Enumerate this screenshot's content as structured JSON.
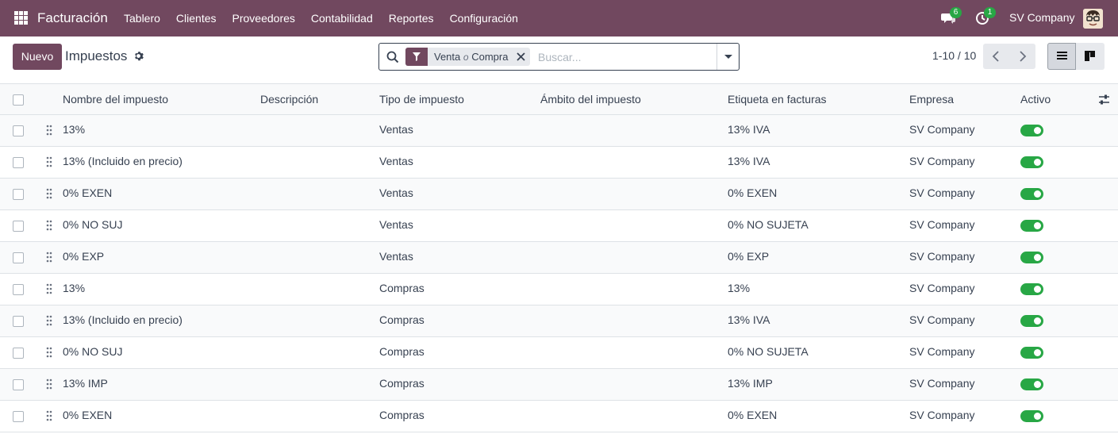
{
  "navbar": {
    "brand": "Facturación",
    "menu": [
      "Tablero",
      "Clientes",
      "Proveedores",
      "Contabilidad",
      "Reportes",
      "Configuración"
    ],
    "messages_badge": "6",
    "activities_badge": "1",
    "company": "SV Company"
  },
  "control_panel": {
    "new_button": "Nuevo",
    "title": "Impuestos",
    "facet": {
      "value1": "Venta",
      "separator": "o",
      "value2": "Compra"
    },
    "search_placeholder": "Buscar...",
    "pager": "1-10 / 10"
  },
  "table": {
    "columns": [
      "Nombre del impuesto",
      "Descripción",
      "Tipo de impuesto",
      "Ámbito del impuesto",
      "Etiqueta en facturas",
      "Empresa",
      "Activo"
    ],
    "rows": [
      {
        "name": "13%",
        "description": "",
        "type": "Ventas",
        "scope": "",
        "label": "13% IVA",
        "company": "SV Company",
        "active": true
      },
      {
        "name": "13% (Incluido en precio)",
        "description": "",
        "type": "Ventas",
        "scope": "",
        "label": "13% IVA",
        "company": "SV Company",
        "active": true
      },
      {
        "name": "0% EXEN",
        "description": "",
        "type": "Ventas",
        "scope": "",
        "label": "0% EXEN",
        "company": "SV Company",
        "active": true
      },
      {
        "name": "0% NO SUJ",
        "description": "",
        "type": "Ventas",
        "scope": "",
        "label": "0% NO SUJETA",
        "company": "SV Company",
        "active": true
      },
      {
        "name": "0% EXP",
        "description": "",
        "type": "Ventas",
        "scope": "",
        "label": "0% EXP",
        "company": "SV Company",
        "active": true
      },
      {
        "name": "13%",
        "description": "",
        "type": "Compras",
        "scope": "",
        "label": "13%",
        "company": "SV Company",
        "active": true
      },
      {
        "name": "13% (Incluido en precio)",
        "description": "",
        "type": "Compras",
        "scope": "",
        "label": "13% IVA",
        "company": "SV Company",
        "active": true
      },
      {
        "name": "0% NO SUJ",
        "description": "",
        "type": "Compras",
        "scope": "",
        "label": "0% NO SUJETA",
        "company": "SV Company",
        "active": true
      },
      {
        "name": "13% IMP",
        "description": "",
        "type": "Compras",
        "scope": "",
        "label": "13% IMP",
        "company": "SV Company",
        "active": true
      },
      {
        "name": "0% EXEN",
        "description": "",
        "type": "Compras",
        "scope": "",
        "label": "0% EXEN",
        "company": "SV Company",
        "active": true
      }
    ]
  },
  "colors": {
    "brand": "#71485f",
    "toggle_on": "#28a745",
    "badge": "#28a745"
  }
}
